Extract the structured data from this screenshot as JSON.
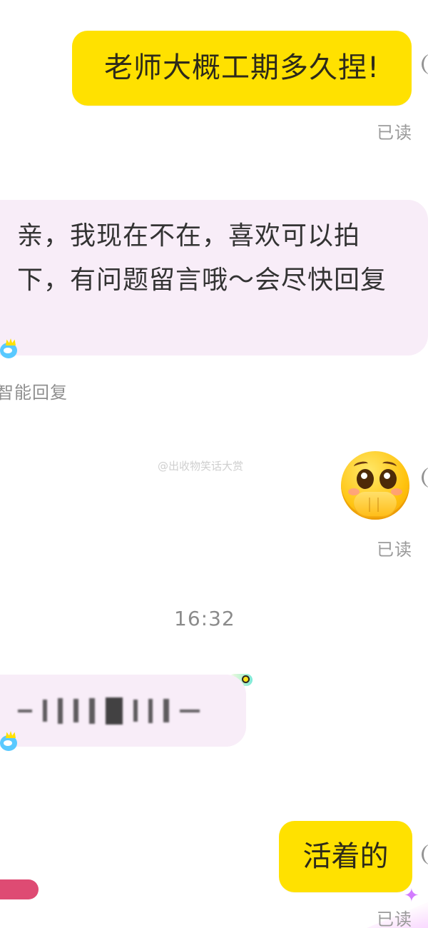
{
  "messages": {
    "first_outgoing": "老师大概工期多久捏!",
    "first_status": "已读",
    "auto_reply": "亲，我现在不在，喜欢可以拍下，有问题留言哦～会尽快回复",
    "auto_reply_note": "智能回复",
    "emoji_status": "已读",
    "timestamp": "16:32",
    "alive_message": "活着的",
    "alive_status": "已读"
  },
  "watermark": {
    "text": "@出收物笑话大赏"
  },
  "icons": {
    "mascot": "mascot-icon",
    "emoji": "pleading-face-emoji",
    "stars": "sparkle-icon"
  },
  "colors": {
    "outgoing_bubble": "#ffe100",
    "incoming_bubble": "#f8edf8",
    "status_text": "#9a9a9a",
    "accent_pink": "#de4b73"
  }
}
